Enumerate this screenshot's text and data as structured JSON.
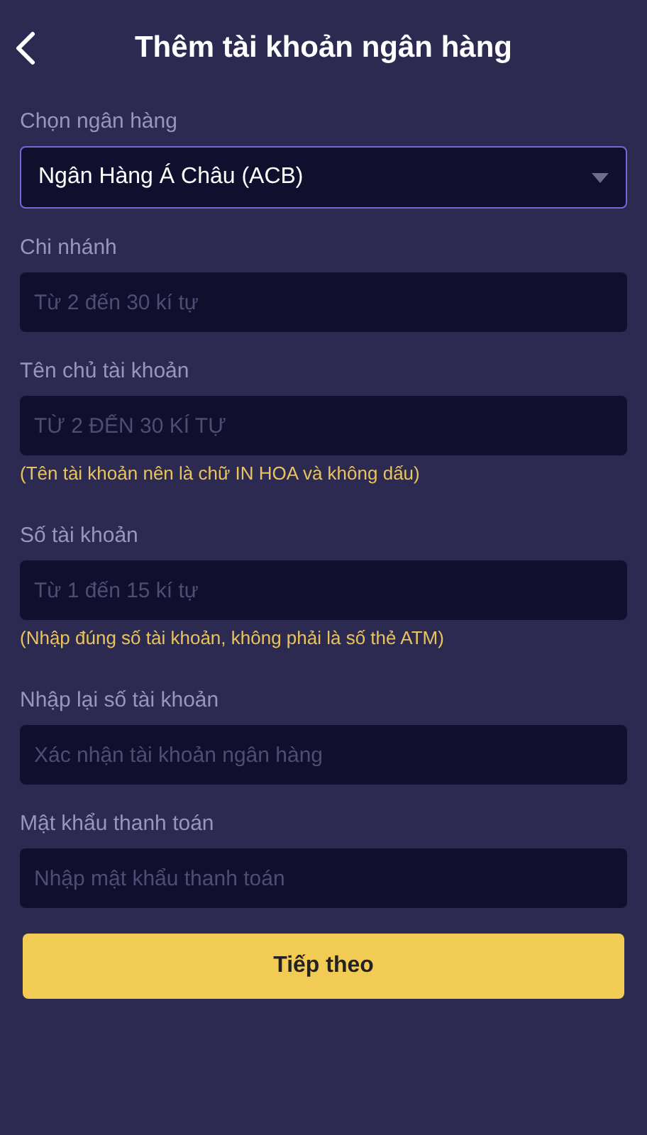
{
  "header": {
    "title": "Thêm tài khoản ngân hàng"
  },
  "fields": [
    {
      "kind": "select",
      "label": "Chọn ngân hàng",
      "value": "Ngân Hàng Á Châu (ACB)"
    },
    {
      "kind": "text",
      "label": "Chi nhánh",
      "placeholder": "Từ 2 đến 30 kí tự"
    },
    {
      "kind": "text",
      "label": "Tên chủ tài khoản",
      "placeholder": "TỪ 2 ĐẾN 30 KÍ TỰ",
      "note": "(Tên tài khoản nên là chữ IN HOA và không dấu)"
    },
    {
      "kind": "text",
      "label": "Số tài khoản",
      "placeholder": "Từ 1 đến 15 kí tự",
      "note": "(Nhập đúng số tài khoản, không phải là số thẻ ATM)"
    },
    {
      "kind": "text",
      "label": "Nhập lại số tài khoản",
      "placeholder": "Xác nhận tài khoản ngân hàng"
    },
    {
      "kind": "password",
      "label": "Mật khẩu thanh toán",
      "placeholder": "Nhập mật khẩu thanh toán"
    }
  ],
  "submit_button": "Tiếp theo"
}
